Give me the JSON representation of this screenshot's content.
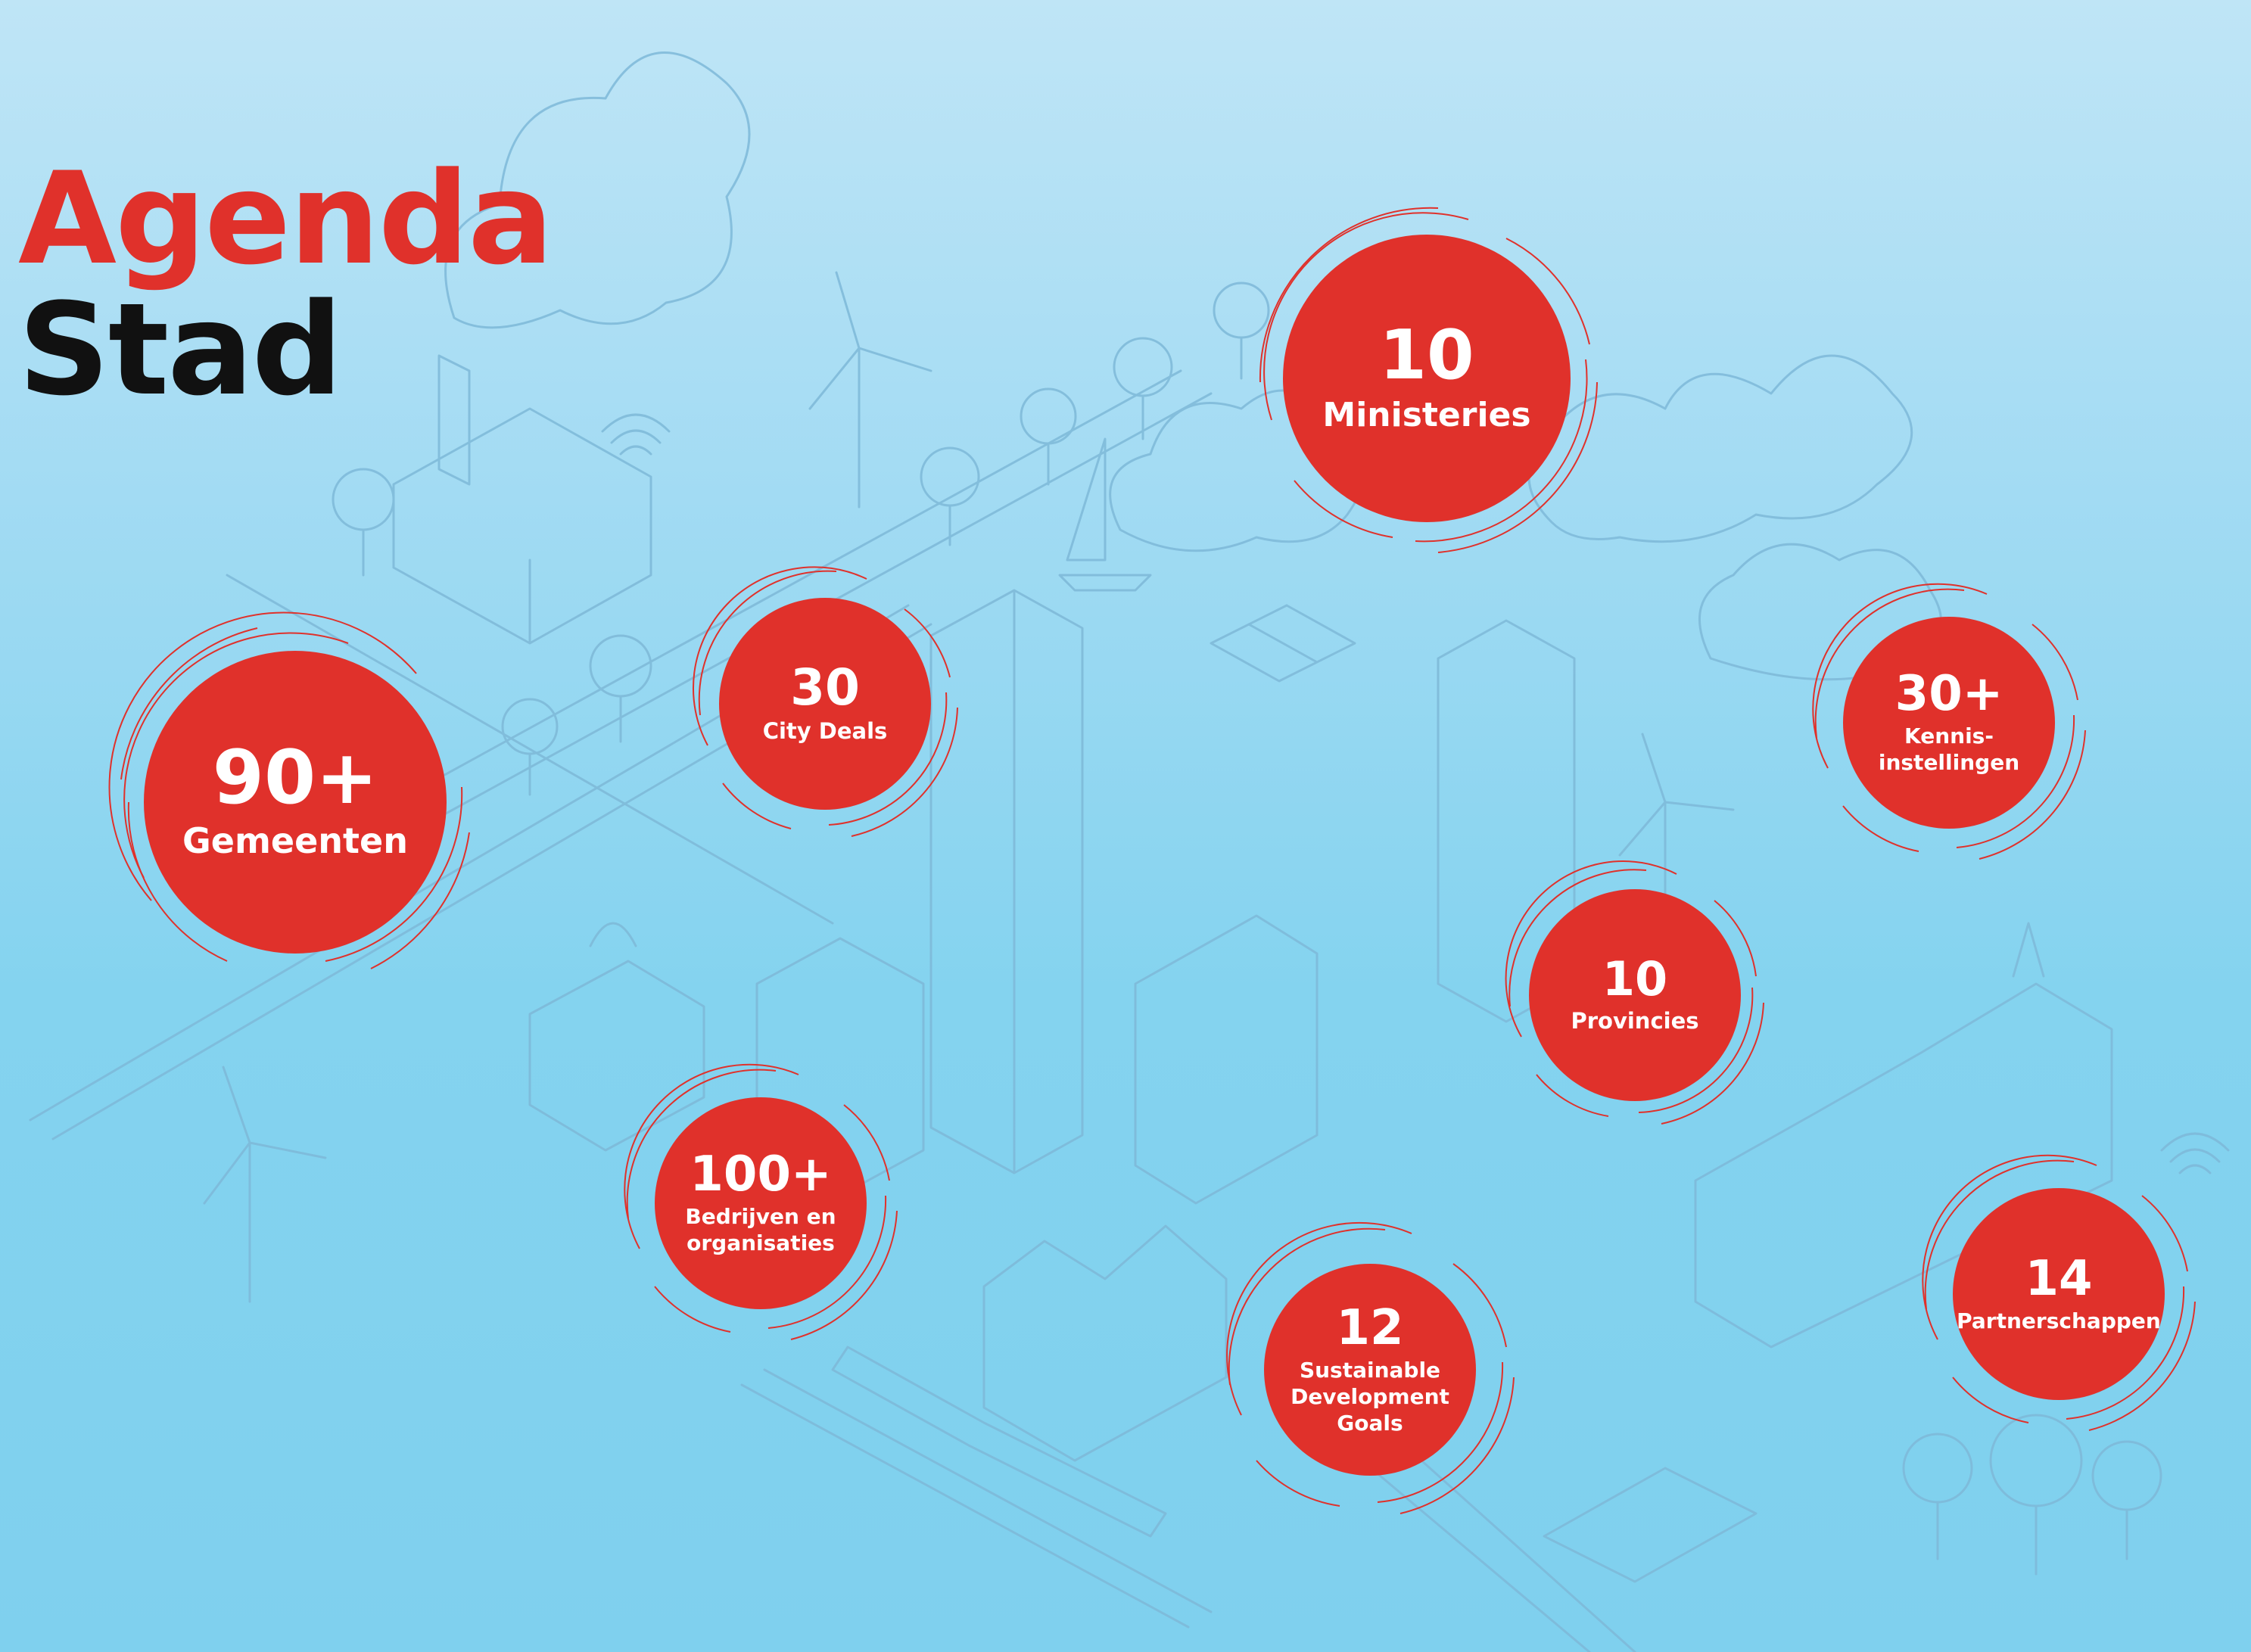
{
  "title": {
    "line1": "Agenda",
    "line2": "Stad"
  },
  "colors": {
    "accent": "#e0312b",
    "title_dark": "#111111",
    "line_art": "#7eb9d8",
    "text_on_accent": "#ffffff"
  },
  "stats": [
    {
      "id": "gemeenten",
      "number": "90+",
      "label": "Gemeenten"
    },
    {
      "id": "city-deals",
      "number": "30",
      "label": "City Deals"
    },
    {
      "id": "ministeries",
      "number": "10",
      "label": "Ministeries"
    },
    {
      "id": "kennisinstellingen",
      "number": "30+",
      "label": "Kennis-\ninstellingen"
    },
    {
      "id": "provincies",
      "number": "10",
      "label": "Provincies"
    },
    {
      "id": "bedrijven",
      "number": "100+",
      "label": "Bedrijven en\norganisaties"
    },
    {
      "id": "sdg",
      "number": "12",
      "label": "Sustainable\nDevelopment\nGoals"
    },
    {
      "id": "partnerschappen",
      "number": "14",
      "label": "Partnerschappen"
    }
  ]
}
